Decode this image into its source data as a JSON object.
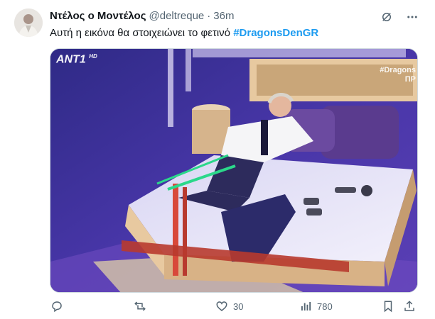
{
  "tweet": {
    "author_name": "Ντέλος ο Μοντέλος",
    "handle": "@deltreque",
    "separator": "·",
    "time": "36m",
    "text": "Αυτή η εικόνα θα στοιχειώνει το φετινό",
    "hashtag": "#DragonsDenGR"
  },
  "media": {
    "channel_logo": "ANT1",
    "channel_sub": "HD",
    "overlay_hashtag": "#Dragons",
    "overlay_sub": "ΠΡ"
  },
  "actions": {
    "reply_count": "",
    "retweet_count": "",
    "like_count": "30",
    "views_count": "780"
  },
  "icons": {
    "grok": "grok-icon",
    "more": "more-icon",
    "reply": "reply-icon",
    "retweet": "retweet-icon",
    "like": "heart-icon",
    "views": "views-icon",
    "bookmark": "bookmark-icon",
    "share": "share-icon"
  },
  "colors": {
    "accent": "#1d9bf0",
    "muted": "#536471",
    "text": "#0f1419"
  }
}
